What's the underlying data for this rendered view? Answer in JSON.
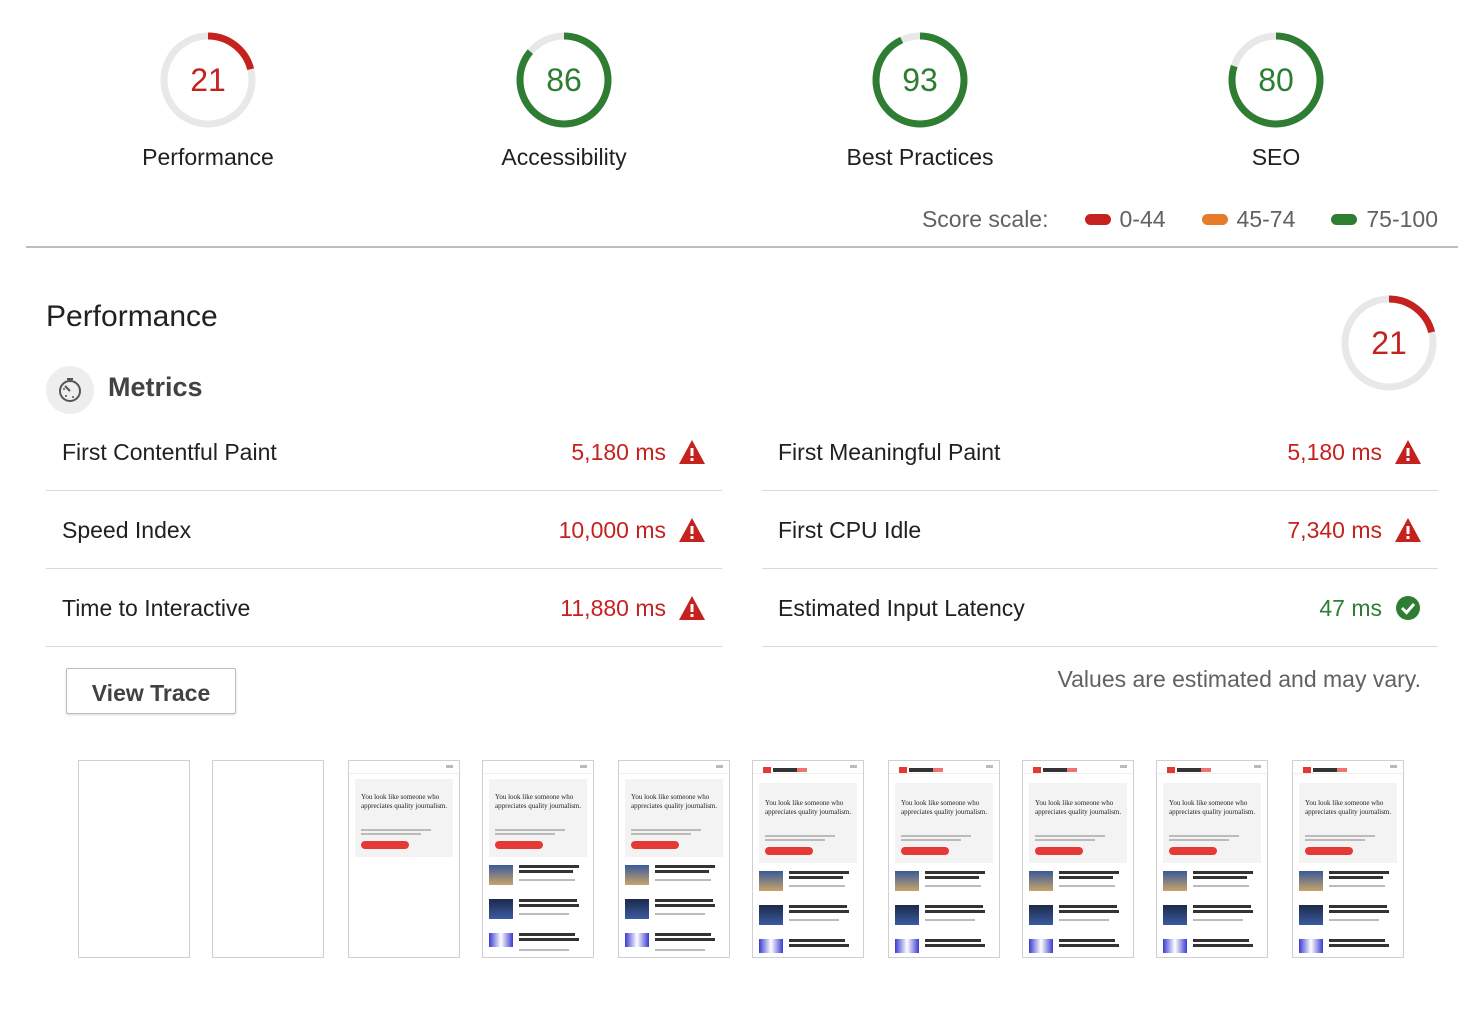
{
  "categories": [
    {
      "name": "Performance",
      "score": 21,
      "status": "fail"
    },
    {
      "name": "Accessibility",
      "score": 86,
      "status": "pass"
    },
    {
      "name": "Best Practices",
      "score": 93,
      "status": "pass"
    },
    {
      "name": "SEO",
      "score": 80,
      "status": "pass"
    }
  ],
  "score_scale": {
    "label": "Score scale:",
    "ranges": [
      {
        "label": "0-44",
        "color": "#c5221f"
      },
      {
        "label": "45-74",
        "color": "#e67c2a"
      },
      {
        "label": "75-100",
        "color": "#2e7d32"
      }
    ]
  },
  "performance": {
    "title": "Performance",
    "score": 21,
    "metrics_title": "Metrics",
    "metrics": [
      {
        "name": "First Contentful Paint",
        "value": "5,180 ms",
        "status": "fail"
      },
      {
        "name": "First Meaningful Paint",
        "value": "5,180 ms",
        "status": "fail"
      },
      {
        "name": "Speed Index",
        "value": "10,000 ms",
        "status": "fail"
      },
      {
        "name": "First CPU Idle",
        "value": "7,340 ms",
        "status": "fail"
      },
      {
        "name": "Time to Interactive",
        "value": "11,880 ms",
        "status": "fail"
      },
      {
        "name": "Estimated Input Latency",
        "value": "47 ms",
        "status": "pass"
      }
    ],
    "view_trace_label": "View Trace",
    "estimate_note": "Values are estimated and may vary."
  },
  "filmstrip": {
    "frame_count": 10,
    "headline": "You look like someone who appreciates quality journalism."
  },
  "colors": {
    "fail": "#c5221f",
    "pass": "#2e7d32",
    "average": "#e67c2a",
    "track": "#e8e8ea"
  }
}
